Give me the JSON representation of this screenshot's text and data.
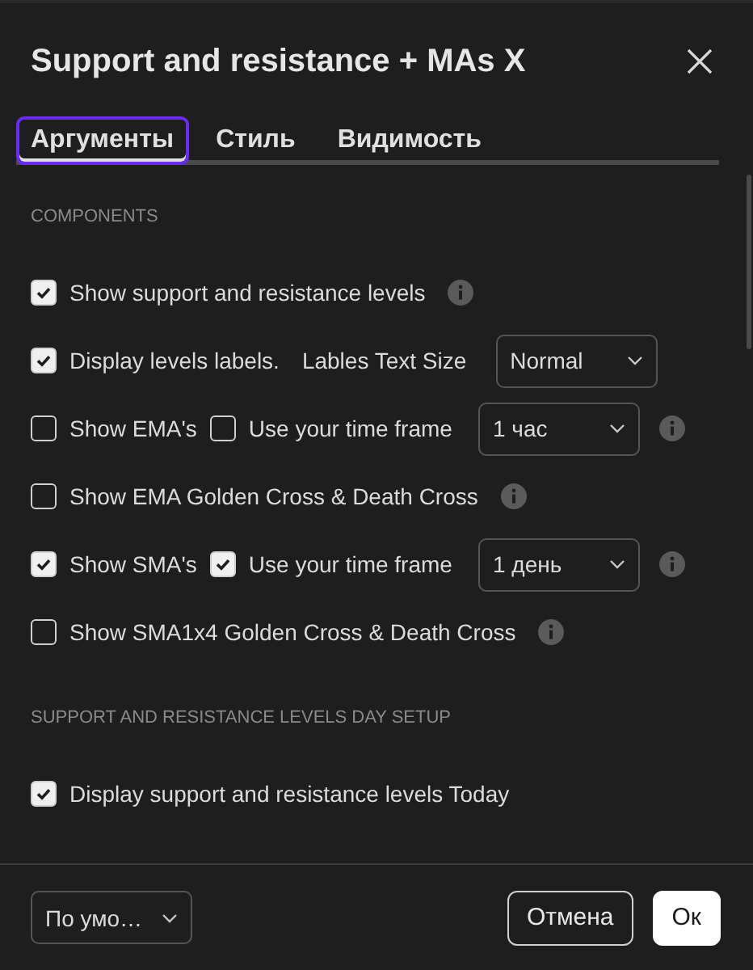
{
  "window": {
    "title": "Support and resistance + MAs X"
  },
  "tabs": [
    {
      "label": "Аргументы",
      "selected": true
    },
    {
      "label": "Стиль",
      "selected": false
    },
    {
      "label": "Видимость",
      "selected": false
    }
  ],
  "sections": [
    {
      "title": "COMPONENTS",
      "rows": [
        {
          "items": [
            {
              "kind": "checkbox",
              "label": "Show support and resistance levels",
              "checked": true
            },
            {
              "kind": "info"
            }
          ]
        },
        {
          "items": [
            {
              "kind": "checkbox",
              "label": "Display levels labels.",
              "checked": true
            },
            {
              "kind": "label",
              "text": "Lables Text Size"
            },
            {
              "kind": "select",
              "value": "Normal"
            }
          ]
        },
        {
          "items": [
            {
              "kind": "checkbox",
              "label": "Show EMA's",
              "checked": false
            },
            {
              "kind": "checkbox",
              "label": "Use your time frame",
              "checked": false
            },
            {
              "kind": "select",
              "value": "1 час"
            },
            {
              "kind": "info"
            }
          ]
        },
        {
          "items": [
            {
              "kind": "checkbox",
              "label": "Show EMA Golden Cross & Death Cross",
              "checked": false
            },
            {
              "kind": "info"
            }
          ]
        },
        {
          "items": [
            {
              "kind": "checkbox",
              "label": "Show SMA's",
              "checked": true
            },
            {
              "kind": "checkbox",
              "label": "Use your time frame",
              "checked": true
            },
            {
              "kind": "select",
              "value": "1 день"
            },
            {
              "kind": "info"
            }
          ]
        },
        {
          "items": [
            {
              "kind": "checkbox",
              "label": "Show SMA1x4 Golden Cross & Death Cross",
              "checked": false
            },
            {
              "kind": "info"
            }
          ]
        }
      ]
    },
    {
      "title": "SUPPORT AND RESISTANCE LEVELS DAY SETUP",
      "rows": [
        {
          "items": [
            {
              "kind": "checkbox",
              "label": "Display support and resistance levels Today",
              "checked": true
            }
          ]
        }
      ]
    }
  ],
  "footer": {
    "preset": "По умо…",
    "cancel": "Отмена",
    "ok": "Ок"
  }
}
